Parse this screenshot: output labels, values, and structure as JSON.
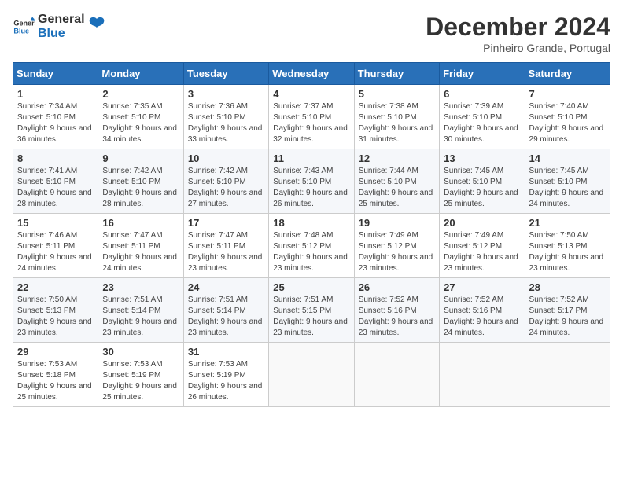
{
  "logo": {
    "text_general": "General",
    "text_blue": "Blue"
  },
  "header": {
    "month_year": "December 2024",
    "location": "Pinheiro Grande, Portugal"
  },
  "weekdays": [
    "Sunday",
    "Monday",
    "Tuesday",
    "Wednesday",
    "Thursday",
    "Friday",
    "Saturday"
  ],
  "weeks": [
    [
      {
        "day": "1",
        "sunrise": "7:34 AM",
        "sunset": "5:10 PM",
        "daylight": "9 hours and 36 minutes."
      },
      {
        "day": "2",
        "sunrise": "7:35 AM",
        "sunset": "5:10 PM",
        "daylight": "9 hours and 34 minutes."
      },
      {
        "day": "3",
        "sunrise": "7:36 AM",
        "sunset": "5:10 PM",
        "daylight": "9 hours and 33 minutes."
      },
      {
        "day": "4",
        "sunrise": "7:37 AM",
        "sunset": "5:10 PM",
        "daylight": "9 hours and 32 minutes."
      },
      {
        "day": "5",
        "sunrise": "7:38 AM",
        "sunset": "5:10 PM",
        "daylight": "9 hours and 31 minutes."
      },
      {
        "day": "6",
        "sunrise": "7:39 AM",
        "sunset": "5:10 PM",
        "daylight": "9 hours and 30 minutes."
      },
      {
        "day": "7",
        "sunrise": "7:40 AM",
        "sunset": "5:10 PM",
        "daylight": "9 hours and 29 minutes."
      }
    ],
    [
      {
        "day": "8",
        "sunrise": "7:41 AM",
        "sunset": "5:10 PM",
        "daylight": "9 hours and 28 minutes."
      },
      {
        "day": "9",
        "sunrise": "7:42 AM",
        "sunset": "5:10 PM",
        "daylight": "9 hours and 28 minutes."
      },
      {
        "day": "10",
        "sunrise": "7:42 AM",
        "sunset": "5:10 PM",
        "daylight": "9 hours and 27 minutes."
      },
      {
        "day": "11",
        "sunrise": "7:43 AM",
        "sunset": "5:10 PM",
        "daylight": "9 hours and 26 minutes."
      },
      {
        "day": "12",
        "sunrise": "7:44 AM",
        "sunset": "5:10 PM",
        "daylight": "9 hours and 25 minutes."
      },
      {
        "day": "13",
        "sunrise": "7:45 AM",
        "sunset": "5:10 PM",
        "daylight": "9 hours and 25 minutes."
      },
      {
        "day": "14",
        "sunrise": "7:45 AM",
        "sunset": "5:10 PM",
        "daylight": "9 hours and 24 minutes."
      }
    ],
    [
      {
        "day": "15",
        "sunrise": "7:46 AM",
        "sunset": "5:11 PM",
        "daylight": "9 hours and 24 minutes."
      },
      {
        "day": "16",
        "sunrise": "7:47 AM",
        "sunset": "5:11 PM",
        "daylight": "9 hours and 24 minutes."
      },
      {
        "day": "17",
        "sunrise": "7:47 AM",
        "sunset": "5:11 PM",
        "daylight": "9 hours and 23 minutes."
      },
      {
        "day": "18",
        "sunrise": "7:48 AM",
        "sunset": "5:12 PM",
        "daylight": "9 hours and 23 minutes."
      },
      {
        "day": "19",
        "sunrise": "7:49 AM",
        "sunset": "5:12 PM",
        "daylight": "9 hours and 23 minutes."
      },
      {
        "day": "20",
        "sunrise": "7:49 AM",
        "sunset": "5:12 PM",
        "daylight": "9 hours and 23 minutes."
      },
      {
        "day": "21",
        "sunrise": "7:50 AM",
        "sunset": "5:13 PM",
        "daylight": "9 hours and 23 minutes."
      }
    ],
    [
      {
        "day": "22",
        "sunrise": "7:50 AM",
        "sunset": "5:13 PM",
        "daylight": "9 hours and 23 minutes."
      },
      {
        "day": "23",
        "sunrise": "7:51 AM",
        "sunset": "5:14 PM",
        "daylight": "9 hours and 23 minutes."
      },
      {
        "day": "24",
        "sunrise": "7:51 AM",
        "sunset": "5:14 PM",
        "daylight": "9 hours and 23 minutes."
      },
      {
        "day": "25",
        "sunrise": "7:51 AM",
        "sunset": "5:15 PM",
        "daylight": "9 hours and 23 minutes."
      },
      {
        "day": "26",
        "sunrise": "7:52 AM",
        "sunset": "5:16 PM",
        "daylight": "9 hours and 23 minutes."
      },
      {
        "day": "27",
        "sunrise": "7:52 AM",
        "sunset": "5:16 PM",
        "daylight": "9 hours and 24 minutes."
      },
      {
        "day": "28",
        "sunrise": "7:52 AM",
        "sunset": "5:17 PM",
        "daylight": "9 hours and 24 minutes."
      }
    ],
    [
      {
        "day": "29",
        "sunrise": "7:53 AM",
        "sunset": "5:18 PM",
        "daylight": "9 hours and 25 minutes."
      },
      {
        "day": "30",
        "sunrise": "7:53 AM",
        "sunset": "5:19 PM",
        "daylight": "9 hours and 25 minutes."
      },
      {
        "day": "31",
        "sunrise": "7:53 AM",
        "sunset": "5:19 PM",
        "daylight": "9 hours and 26 minutes."
      },
      null,
      null,
      null,
      null
    ]
  ],
  "labels": {
    "sunrise": "Sunrise:",
    "sunset": "Sunset:",
    "daylight": "Daylight:"
  }
}
